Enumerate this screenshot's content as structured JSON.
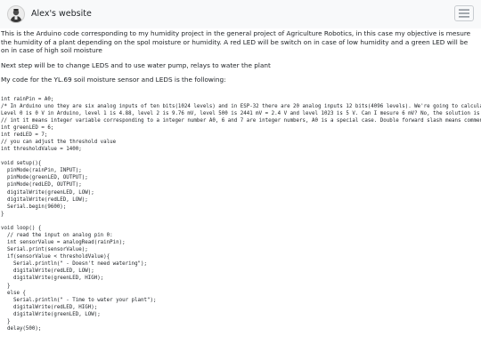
{
  "navbar": {
    "brand": "Alex's website",
    "avatar_icon": "person-avatar-icon",
    "menu_icon": "hamburger-menu-icon"
  },
  "content": {
    "intro": "This is the Arduino code corresponding to my humidity project in the general project of Agriculture Robotics, in this case my objective is mesure the humidity of a plant depending on the spol moisture or humidity. A red LED will be switch on in case of low humidity and a green LED will be on in case of high soil moisture",
    "next_step": "Next step will be to change LEDS and to use water pump, relays to water the plant",
    "code_intro": "My code for the YL.69 soil moisture sensor and LEDS is the following:",
    "code": "int rainPin = A0;\n/* In Arduino uno they are six analog inputs of ten bits(1024 levels) and in ESP-32 there are 20 analog inputs 12 bits(4096 levels). We're going to calculate\nLevel 0 is 0 V in Arduino, level 1 is 4.88, level 2 is 9.76 mV, level 500 is 2441 mV = 2.4 V and level 1023 is 5 V. Can I mesure 6 mV? No, the solution is\n// int it means integer variable corresponding to a integer number A0, 6 and 7 are integer numbers, A0 is a special case. Double forward slash means comment\nint greenLED = 6;\nint redLED = 7;\n// you can adjust the threshold value\nint thresholdValue = 1400;\n\nvoid setup(){\n  pinMode(rainPin, INPUT);\n  pinMode(greenLED, OUTPUT);\n  pinMode(redLED, OUTPUT);\n  digitalWrite(greenLED, LOW);\n  digitalWrite(redLED, LOW);\n  Serial.begin(9600);\n}\n\nvoid loop() {\n  // read the input on analog pin 0:\n  int sensorValue = analogRead(rainPin);\n  Serial.print(sensorValue);\n  if(sensorValue < thresholdValue){\n    Serial.println(\" - Doesn't need watering\");\n    digitalWrite(redLED, LOW);\n    digitalWrite(greenLED, HIGH);\n  }\n  else {\n    Serial.println(\" - Time to water your plant\");\n    digitalWrite(redLED, HIGH);\n    digitalWrite(greenLED, LOW);\n  }\n  delay(500);"
  }
}
